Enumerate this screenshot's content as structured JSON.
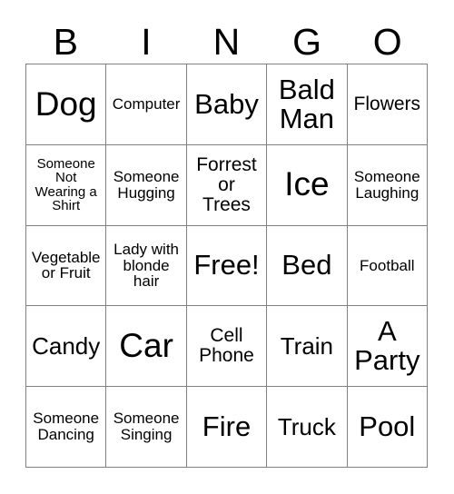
{
  "card": {
    "title": "BINGO",
    "header_letters": [
      "B",
      "I",
      "N",
      "G",
      "O"
    ],
    "grid_size": "5x5",
    "border_color": "#808080",
    "text_color": "#000000",
    "background_color": "#ffffff",
    "rows": [
      [
        {
          "label": "Dog",
          "size": "fs-xl"
        },
        {
          "label": "Computer",
          "size": "fs-xs"
        },
        {
          "label": "Baby",
          "size": "fs-lg"
        },
        {
          "label": "Bald\nMan",
          "size": "fs-lg"
        },
        {
          "label": "Flowers",
          "size": "fs-sm"
        }
      ],
      [
        {
          "label": "Someone\nNot\nWearing a\nShirt",
          "size": "fs-xxs"
        },
        {
          "label": "Someone\nHugging",
          "size": "fs-xs"
        },
        {
          "label": "Forrest\nor\nTrees",
          "size": "fs-sm"
        },
        {
          "label": "Ice",
          "size": "fs-xl"
        },
        {
          "label": "Someone\nLaughing",
          "size": "fs-xs"
        }
      ],
      [
        {
          "label": "Vegetable\nor Fruit",
          "size": "fs-xs"
        },
        {
          "label": "Lady with\nblonde\nhair",
          "size": "fs-xs"
        },
        {
          "label": "Free!",
          "size": "fs-lg"
        },
        {
          "label": "Bed",
          "size": "fs-lg"
        },
        {
          "label": "Football",
          "size": "fs-xs"
        }
      ],
      [
        {
          "label": "Candy",
          "size": "fs-md"
        },
        {
          "label": "Car",
          "size": "fs-xl"
        },
        {
          "label": "Cell\nPhone",
          "size": "fs-sm"
        },
        {
          "label": "Train",
          "size": "fs-md"
        },
        {
          "label": "A\nParty",
          "size": "fs-lg"
        }
      ],
      [
        {
          "label": "Someone\nDancing",
          "size": "fs-xs"
        },
        {
          "label": "Someone\nSinging",
          "size": "fs-xs"
        },
        {
          "label": "Fire",
          "size": "fs-lg"
        },
        {
          "label": "Truck",
          "size": "fs-md"
        },
        {
          "label": "Pool",
          "size": "fs-lg"
        }
      ]
    ]
  }
}
